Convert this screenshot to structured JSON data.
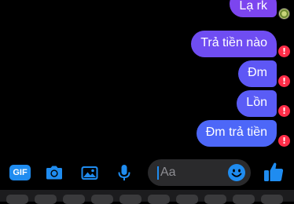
{
  "messages": [
    {
      "text": "Lạ rk",
      "status": "seen"
    },
    {
      "text": "Trả tiền nào",
      "status": "failed"
    },
    {
      "text": "Đm",
      "status": "failed"
    },
    {
      "text": "Lồn",
      "status": "failed"
    },
    {
      "text": "Đm trả tiền",
      "status": "failed"
    }
  ],
  "error_glyph": "!",
  "composer": {
    "gif_label": "GIF",
    "placeholder": "Aa"
  },
  "colors": {
    "accent": "#1f8cf0",
    "error": "#ff2d48",
    "bubble_top": "#7c45ef",
    "bubble_bottom": "#4d67f8"
  },
  "icons": [
    "gif-icon",
    "camera-icon",
    "gallery-icon",
    "microphone-icon",
    "emoji-icon",
    "thumbs-up-icon"
  ]
}
